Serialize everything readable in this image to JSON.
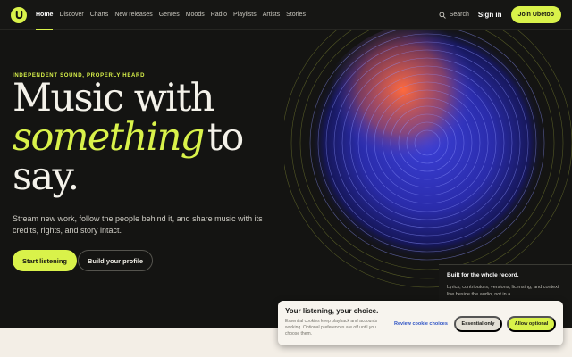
{
  "nav": {
    "logo": "ubetoo-logo-icon",
    "links": [
      "Home",
      "Discover",
      "Charts",
      "New releases",
      "Genres",
      "Moods",
      "Radio",
      "Playlists",
      "Artists",
      "Stories"
    ],
    "active": "Home",
    "search_label": "Search",
    "signin_label": "Sign in",
    "join_label": "Join Ubetoo"
  },
  "hero": {
    "eyebrow": "INDEPENDENT SOUND, PROPERLY HEARD",
    "title_line1": "Music with",
    "title_emphasis": "something",
    "title_line2_rest": "to",
    "title_line3": "say.",
    "lede": "Stream new work, follow the people behind it, and share music with its credits, rights, and story intact.",
    "primary_button": "Start listening",
    "secondary_button": "Build your profile"
  },
  "side_card": {
    "title": "Built for the whole record.",
    "text": "Lyrics, contributors, versions, licensing, and context live beside the audio, not in a"
  },
  "cookie": {
    "title": "Your listening, your choice.",
    "text": "Essential cookies keep playback and accounts working. Optional preferences are off until you choose them.",
    "review_link": "Review cookie choices",
    "essential_button": "Essential only",
    "allow_button": "Allow optional"
  },
  "colors": {
    "accent": "#d9f24a",
    "background": "#141412",
    "orb_blue": "#3b3fd6",
    "orb_orange": "#ff6a3d",
    "link_blue": "#2f54c5"
  }
}
